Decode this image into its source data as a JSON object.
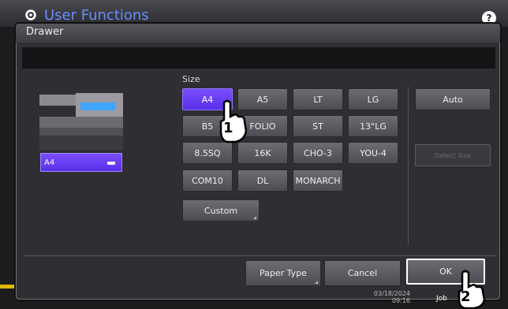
{
  "app": {
    "title": "User Functions",
    "help_label": "?"
  },
  "dialog": {
    "title": "Drawer",
    "size_label": "Size",
    "drawer": {
      "selected_size": "A4"
    },
    "sizes": [
      [
        "A4",
        "A5",
        "LT",
        "LG"
      ],
      [
        "B5",
        "FOLIO",
        "ST",
        "13\"LG"
      ],
      [
        "8.5SQ",
        "16K",
        "CHO-3",
        "YOU-4"
      ],
      [
        "COM10",
        "DL",
        "MONARCH"
      ]
    ],
    "selected": "A4",
    "custom_label": "Custom",
    "auto_label": "Auto",
    "detect_size_label": "Detect Size",
    "paper_type_label": "Paper Type",
    "cancel_label": "Cancel",
    "ok_label": "OK"
  },
  "status": {
    "date": "03/18/2024",
    "time": "09:16",
    "job_label": "Job"
  },
  "callouts": {
    "step1": "1",
    "step2": "2"
  },
  "colors": {
    "accent": "#5a2fe8",
    "panel": "#2e2e33",
    "title": "#6a8cff"
  }
}
